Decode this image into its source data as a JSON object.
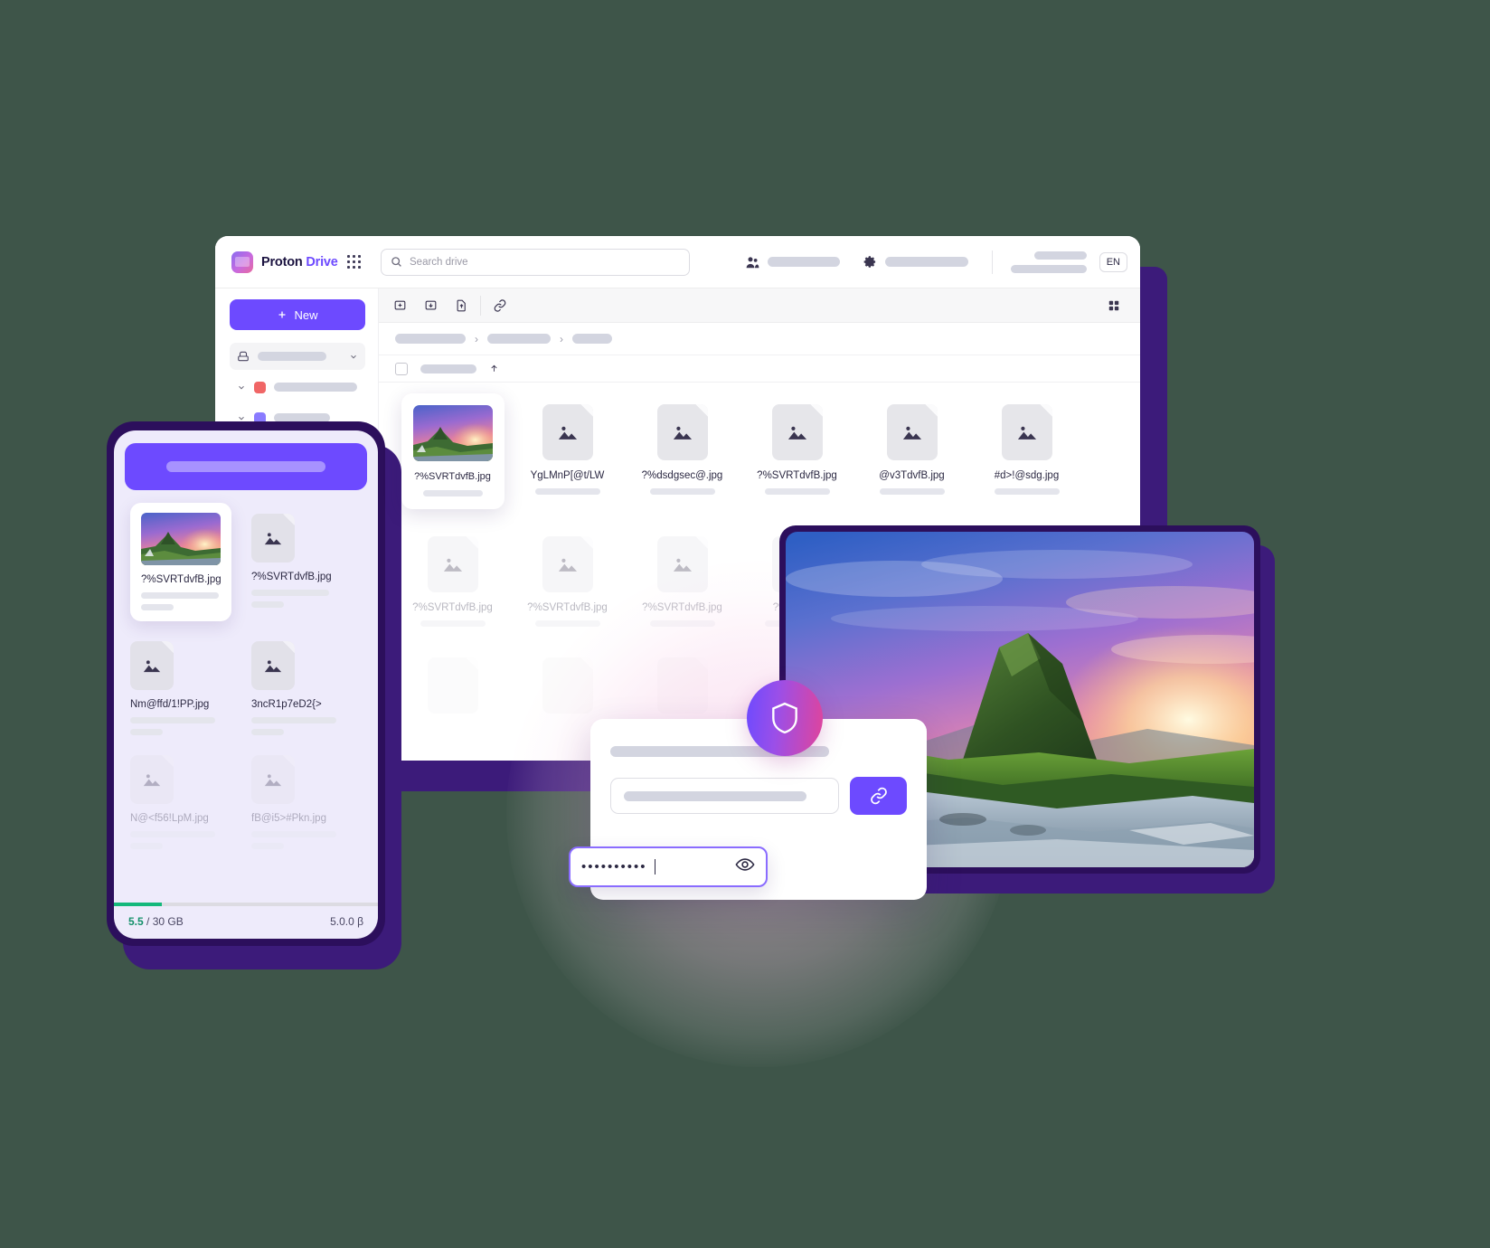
{
  "background_color": "#3e5549",
  "accent": "#6d4aff",
  "desktop": {
    "brand": {
      "name": "Proton",
      "product": "Drive",
      "logo_icon": "proton-drive-logo-icon",
      "apps_icon": "app-grid-icon"
    },
    "search": {
      "placeholder": "Search drive",
      "icon": "search-icon",
      "value": ""
    },
    "header_right": {
      "people_icon": "people-icon",
      "gear_icon": "gear-icon",
      "language_badge": "EN"
    },
    "sidebar": {
      "new_button": {
        "label": "New",
        "icon": "plus-icon"
      },
      "items": [
        {
          "name": "my-files",
          "icon": "drive-icon",
          "chevron": "chevron-down-icon"
        },
        {
          "name": "folder-red",
          "icon": "folder-icon",
          "color": "#f06666",
          "chevron": "chevron-down-icon"
        },
        {
          "name": "folder-violet",
          "icon": "folder-icon",
          "color": "#8a7bff",
          "chevron": "chevron-down-icon"
        },
        {
          "name": "computers",
          "icon": "monitor-icon"
        },
        {
          "name": "shared-links",
          "icon": "link-icon"
        }
      ]
    },
    "toolbar": {
      "buttons": [
        {
          "name": "new-folder",
          "icon": "folder-plus-icon"
        },
        {
          "name": "upload-folder",
          "icon": "folder-arrow-icon"
        },
        {
          "name": "upload-file",
          "icon": "file-arrow-up-icon"
        },
        {
          "name": "create-link",
          "icon": "link-icon"
        }
      ],
      "layout_toggle": {
        "name": "grid-view",
        "icon": "grid-view-icon"
      }
    },
    "breadcrumb": {
      "separator": "›",
      "crumbs": 3
    },
    "list_header": {
      "checkbox": "select-all-checkbox",
      "sort_icon": "arrow-up-icon"
    },
    "files_row_1": [
      {
        "filename": "?%SVRTdvfB.jpg",
        "selected": true,
        "thumb": "photo"
      },
      {
        "filename": "YgLMnP[@t/LW",
        "selected": false,
        "thumb": "image-placeholder"
      },
      {
        "filename": "?%dsdgsec@.jpg",
        "selected": false,
        "thumb": "image-placeholder"
      },
      {
        "filename": "?%SVRTdvfB.jpg",
        "selected": false,
        "thumb": "image-placeholder"
      },
      {
        "filename": "@v3TdvfB.jpg",
        "selected": false,
        "thumb": "image-placeholder"
      },
      {
        "filename": "#d>!@sdg.jpg",
        "selected": false,
        "thumb": "image-placeholder"
      }
    ],
    "files_row_2": [
      {
        "filename": "?%SVRTdvfB.jpg"
      },
      {
        "filename": "?%SVRTdvfB.jpg"
      },
      {
        "filename": "?%SVRTdvfB.jpg"
      },
      {
        "filename": "?%SVRTd"
      },
      {
        "filename": ""
      },
      {
        "filename": ""
      }
    ]
  },
  "phone": {
    "hero_banner": "upgrade-banner",
    "files": [
      {
        "filename": "?%SVRTdvfB.jpg",
        "selected": true,
        "thumb": "photo"
      },
      {
        "filename": "?%SVRTdvfB.jpg",
        "selected": false,
        "thumb": "image-placeholder"
      },
      {
        "filename": "Nm@ffd/1!PP.jpg",
        "selected": false,
        "thumb": "image-placeholder"
      },
      {
        "filename": "3ncR1p7eD2{>",
        "selected": false,
        "thumb": "image-placeholder"
      },
      {
        "filename": "N@<f56!LpM.jpg",
        "selected": false,
        "thumb": "image-placeholder"
      },
      {
        "filename": "fB@i5>#Pkn.jpg",
        "selected": false,
        "thumb": "image-placeholder"
      }
    ],
    "footer": {
      "used": "5.5",
      "quota": "/ 30 GB",
      "version": "5.0.0 β",
      "progress_percent": 18,
      "progress_color": "#14b87b"
    }
  },
  "tablet": {
    "photo_alt": "kirkjufell-mountain-sunset-photo"
  },
  "share_dialog": {
    "title_placeholder": "share-title-placeholder",
    "link_field": {
      "name": "share-link-input",
      "value": ""
    },
    "copy_button": {
      "name": "copy-link-button",
      "icon": "link-icon"
    },
    "shield_badge": {
      "icon": "shield-icon"
    },
    "password_field": {
      "name": "share-password-input",
      "value": "••••••••••",
      "toggle_icon": "eye-icon"
    }
  }
}
